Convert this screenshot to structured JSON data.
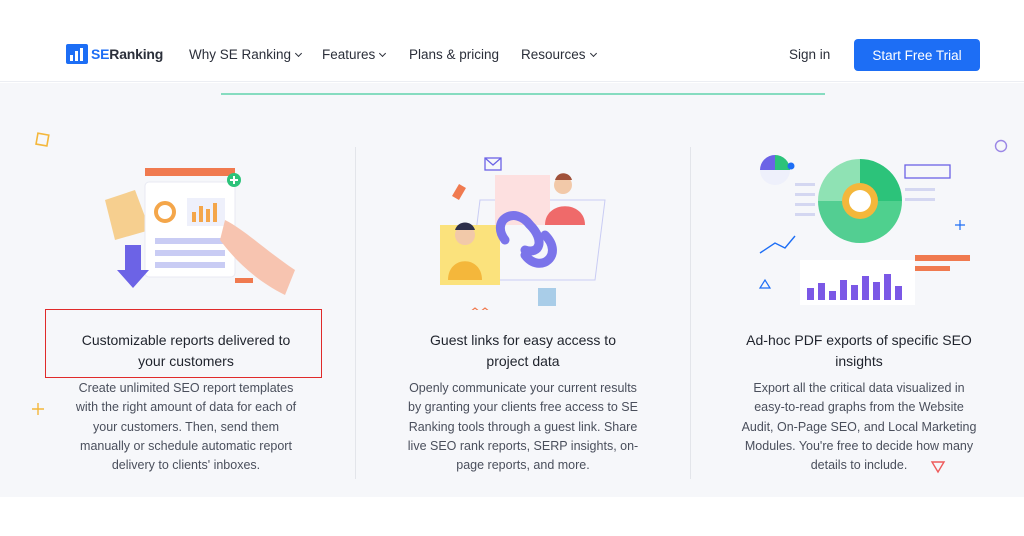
{
  "header": {
    "logo": {
      "brand_a": "SE",
      "brand_b": "Ranking"
    },
    "nav": [
      {
        "label": "Why SE Ranking",
        "has_dropdown": true
      },
      {
        "label": "Features",
        "has_dropdown": true
      },
      {
        "label": "Plans & pricing",
        "has_dropdown": false
      },
      {
        "label": "Resources",
        "has_dropdown": true
      }
    ],
    "sign_in": "Sign in",
    "cta": "Start Free Trial"
  },
  "features": [
    {
      "title_line1": "Customizable reports delivered to",
      "title_line2": "your customers",
      "desc": [
        "Create unlimited SEO report templates",
        "with the right amount of data for each of",
        "your customers. Then, send them",
        "manually or schedule automatic report",
        "delivery to clients' inboxes."
      ],
      "highlighted": true
    },
    {
      "title_line1": "Guest links for easy access to",
      "title_line2": "project data",
      "desc": [
        "Openly communicate your current results",
        "by granting your clients free access to SE",
        "Ranking tools through a guest link. Share",
        "live SEO rank reports, SERP insights, on-",
        "page reports, and more."
      ],
      "highlighted": false
    },
    {
      "title_line1": "Ad-hoc PDF exports of specific SEO",
      "title_line2": "insights",
      "desc": [
        "Export all the critical data visualized in",
        "easy-to-read graphs from the Website",
        "Audit, On-Page SEO, and Local Marketing",
        "Modules. You're free to decide how many",
        "details to include."
      ],
      "highlighted": false
    }
  ],
  "colors": {
    "accent": "#1d6ef5",
    "highlight_border": "#e02a2a",
    "band_bg": "#f6f7fa"
  }
}
